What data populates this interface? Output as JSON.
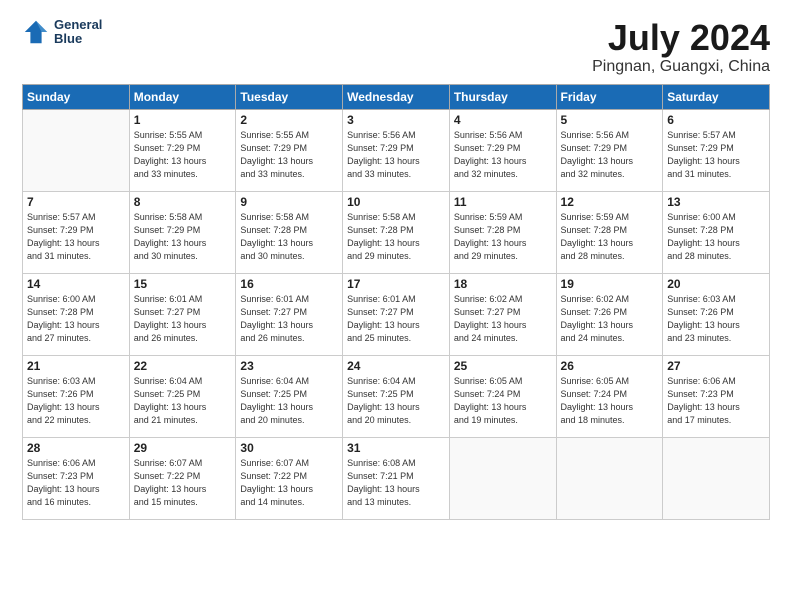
{
  "header": {
    "logo_line1": "General",
    "logo_line2": "Blue",
    "title": "July 2024",
    "subtitle": "Pingnan, Guangxi, China"
  },
  "columns": [
    "Sunday",
    "Monday",
    "Tuesday",
    "Wednesday",
    "Thursday",
    "Friday",
    "Saturday"
  ],
  "weeks": [
    [
      {
        "day": "",
        "info": ""
      },
      {
        "day": "1",
        "info": "Sunrise: 5:55 AM\nSunset: 7:29 PM\nDaylight: 13 hours\nand 33 minutes."
      },
      {
        "day": "2",
        "info": "Sunrise: 5:55 AM\nSunset: 7:29 PM\nDaylight: 13 hours\nand 33 minutes."
      },
      {
        "day": "3",
        "info": "Sunrise: 5:56 AM\nSunset: 7:29 PM\nDaylight: 13 hours\nand 33 minutes."
      },
      {
        "day": "4",
        "info": "Sunrise: 5:56 AM\nSunset: 7:29 PM\nDaylight: 13 hours\nand 32 minutes."
      },
      {
        "day": "5",
        "info": "Sunrise: 5:56 AM\nSunset: 7:29 PM\nDaylight: 13 hours\nand 32 minutes."
      },
      {
        "day": "6",
        "info": "Sunrise: 5:57 AM\nSunset: 7:29 PM\nDaylight: 13 hours\nand 31 minutes."
      }
    ],
    [
      {
        "day": "7",
        "info": "Sunrise: 5:57 AM\nSunset: 7:29 PM\nDaylight: 13 hours\nand 31 minutes."
      },
      {
        "day": "8",
        "info": "Sunrise: 5:58 AM\nSunset: 7:29 PM\nDaylight: 13 hours\nand 30 minutes."
      },
      {
        "day": "9",
        "info": "Sunrise: 5:58 AM\nSunset: 7:28 PM\nDaylight: 13 hours\nand 30 minutes."
      },
      {
        "day": "10",
        "info": "Sunrise: 5:58 AM\nSunset: 7:28 PM\nDaylight: 13 hours\nand 29 minutes."
      },
      {
        "day": "11",
        "info": "Sunrise: 5:59 AM\nSunset: 7:28 PM\nDaylight: 13 hours\nand 29 minutes."
      },
      {
        "day": "12",
        "info": "Sunrise: 5:59 AM\nSunset: 7:28 PM\nDaylight: 13 hours\nand 28 minutes."
      },
      {
        "day": "13",
        "info": "Sunrise: 6:00 AM\nSunset: 7:28 PM\nDaylight: 13 hours\nand 28 minutes."
      }
    ],
    [
      {
        "day": "14",
        "info": "Sunrise: 6:00 AM\nSunset: 7:28 PM\nDaylight: 13 hours\nand 27 minutes."
      },
      {
        "day": "15",
        "info": "Sunrise: 6:01 AM\nSunset: 7:27 PM\nDaylight: 13 hours\nand 26 minutes."
      },
      {
        "day": "16",
        "info": "Sunrise: 6:01 AM\nSunset: 7:27 PM\nDaylight: 13 hours\nand 26 minutes."
      },
      {
        "day": "17",
        "info": "Sunrise: 6:01 AM\nSunset: 7:27 PM\nDaylight: 13 hours\nand 25 minutes."
      },
      {
        "day": "18",
        "info": "Sunrise: 6:02 AM\nSunset: 7:27 PM\nDaylight: 13 hours\nand 24 minutes."
      },
      {
        "day": "19",
        "info": "Sunrise: 6:02 AM\nSunset: 7:26 PM\nDaylight: 13 hours\nand 24 minutes."
      },
      {
        "day": "20",
        "info": "Sunrise: 6:03 AM\nSunset: 7:26 PM\nDaylight: 13 hours\nand 23 minutes."
      }
    ],
    [
      {
        "day": "21",
        "info": "Sunrise: 6:03 AM\nSunset: 7:26 PM\nDaylight: 13 hours\nand 22 minutes."
      },
      {
        "day": "22",
        "info": "Sunrise: 6:04 AM\nSunset: 7:25 PM\nDaylight: 13 hours\nand 21 minutes."
      },
      {
        "day": "23",
        "info": "Sunrise: 6:04 AM\nSunset: 7:25 PM\nDaylight: 13 hours\nand 20 minutes."
      },
      {
        "day": "24",
        "info": "Sunrise: 6:04 AM\nSunset: 7:25 PM\nDaylight: 13 hours\nand 20 minutes."
      },
      {
        "day": "25",
        "info": "Sunrise: 6:05 AM\nSunset: 7:24 PM\nDaylight: 13 hours\nand 19 minutes."
      },
      {
        "day": "26",
        "info": "Sunrise: 6:05 AM\nSunset: 7:24 PM\nDaylight: 13 hours\nand 18 minutes."
      },
      {
        "day": "27",
        "info": "Sunrise: 6:06 AM\nSunset: 7:23 PM\nDaylight: 13 hours\nand 17 minutes."
      }
    ],
    [
      {
        "day": "28",
        "info": "Sunrise: 6:06 AM\nSunset: 7:23 PM\nDaylight: 13 hours\nand 16 minutes."
      },
      {
        "day": "29",
        "info": "Sunrise: 6:07 AM\nSunset: 7:22 PM\nDaylight: 13 hours\nand 15 minutes."
      },
      {
        "day": "30",
        "info": "Sunrise: 6:07 AM\nSunset: 7:22 PM\nDaylight: 13 hours\nand 14 minutes."
      },
      {
        "day": "31",
        "info": "Sunrise: 6:08 AM\nSunset: 7:21 PM\nDaylight: 13 hours\nand 13 minutes."
      },
      {
        "day": "",
        "info": ""
      },
      {
        "day": "",
        "info": ""
      },
      {
        "day": "",
        "info": ""
      }
    ]
  ]
}
